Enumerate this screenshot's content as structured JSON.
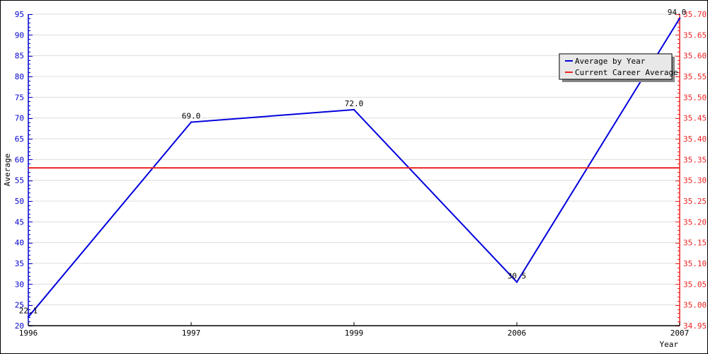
{
  "chart_data": {
    "type": "line",
    "title": "",
    "xlabel": "Year",
    "ylabel": "Average",
    "categories": [
      "1996",
      "1997",
      "1999",
      "2006",
      "2007"
    ],
    "series": [
      {
        "name": "Average by Year",
        "color": "#0000dd",
        "axis": "left",
        "values": [
          22.1,
          69.0,
          72.0,
          30.5,
          94.0
        ],
        "labels": [
          "22.1",
          "69.0",
          "72.0",
          "30.5",
          "94.0"
        ]
      },
      {
        "name": "Current Career Average",
        "color": "#ee2222",
        "axis": "right",
        "type": "hline",
        "value": 35.33
      }
    ],
    "y_left": {
      "range": [
        20,
        95
      ],
      "ticks": [
        "20",
        "25",
        "30",
        "35",
        "40",
        "45",
        "50",
        "55",
        "60",
        "65",
        "70",
        "75",
        "80",
        "85",
        "90",
        "95"
      ],
      "color": "#0000cc"
    },
    "y_right": {
      "range": [
        34.95,
        35.7
      ],
      "ticks": [
        "34.95",
        "35.00",
        "35.05",
        "35.10",
        "35.15",
        "35.20",
        "35.25",
        "35.30",
        "35.35",
        "35.40",
        "35.45",
        "35.50",
        "35.55",
        "35.60",
        "35.65",
        "35.70"
      ],
      "color": "#ee2222"
    },
    "grid": true,
    "legend": {
      "position": "top-right",
      "entries": [
        "Average by Year",
        "Current Career Average"
      ]
    }
  }
}
